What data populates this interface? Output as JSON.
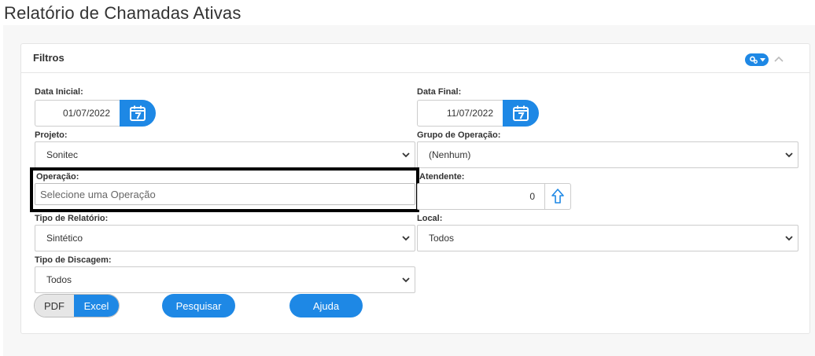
{
  "page": {
    "title": "Relatório de Chamadas Ativas"
  },
  "filters": {
    "title": "Filtros",
    "data_inicial": {
      "label": "Data Inicial:",
      "value": "01/07/2022"
    },
    "data_final": {
      "label": "Data Final:",
      "value": "11/07/2022"
    },
    "projeto": {
      "label": "Projeto:",
      "value": "Sonitec"
    },
    "grupo_operacao": {
      "label": "Grupo de Operação:",
      "value": "(Nenhum)"
    },
    "operacao": {
      "label": "Operação:",
      "placeholder": "Selecione uma Operação"
    },
    "atendente": {
      "label": "Atendente:",
      "value": "0"
    },
    "tipo_relatorio": {
      "label": "Tipo de Relatório:",
      "value": "Sintético"
    },
    "local": {
      "label": "Local:",
      "value": "Todos"
    },
    "tipo_discagem": {
      "label": "Tipo de Discagem:",
      "value": "Todos"
    }
  },
  "actions": {
    "format_pdf": "PDF",
    "format_excel": "Excel",
    "search": "Pesquisar",
    "help": "Ajuda"
  },
  "icons": {
    "calendar": "calendar-icon",
    "gear": "gear-icon",
    "collapse": "chevron-up-icon",
    "dropdown": "chevron-down-icon",
    "up": "arrow-up-icon"
  },
  "colors": {
    "accent": "#1e88e5",
    "highlight_border": "#000000"
  }
}
